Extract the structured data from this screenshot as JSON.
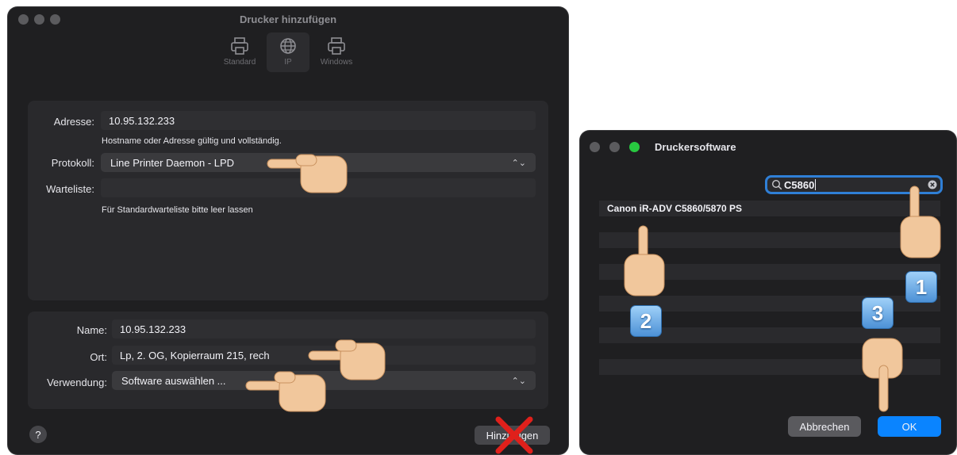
{
  "add_printer": {
    "title": "Drucker hinzufügen",
    "toolbar": [
      {
        "label": "Standard",
        "icon": "printer-icon"
      },
      {
        "label": "IP",
        "icon": "globe-icon"
      },
      {
        "label": "Windows",
        "icon": "printer-icon"
      }
    ],
    "address": {
      "label": "Adresse:",
      "value": "10.95.132.233",
      "hint": "Hostname oder Adresse gültig und vollständig."
    },
    "protocol": {
      "label": "Protokoll:",
      "value": "Line Printer Daemon - LPD"
    },
    "queue": {
      "label": "Warteliste:",
      "value": "",
      "hint": "Für Standardwarteliste bitte leer lassen"
    },
    "name": {
      "label": "Name:",
      "value": "10.95.132.233"
    },
    "location": {
      "label": "Ort:",
      "value": "Lp, 2. OG, Kopierraum 215, rech"
    },
    "usage": {
      "label": "Verwendung:",
      "value": "Software auswählen ..."
    },
    "help_label": "?",
    "add_button": "Hinzufügen"
  },
  "printer_software": {
    "title": "Druckersoftware",
    "search_value": "C5860",
    "results": [
      "Canon iR-ADV C5860/5870 PS"
    ],
    "cancel_button": "Abbrechen",
    "ok_button": "OK"
  },
  "badges": [
    "1",
    "2",
    "3"
  ],
  "colors": {
    "accent": "#0a84ff",
    "close_mark": "#e0201b",
    "green_light": "#28c840"
  }
}
